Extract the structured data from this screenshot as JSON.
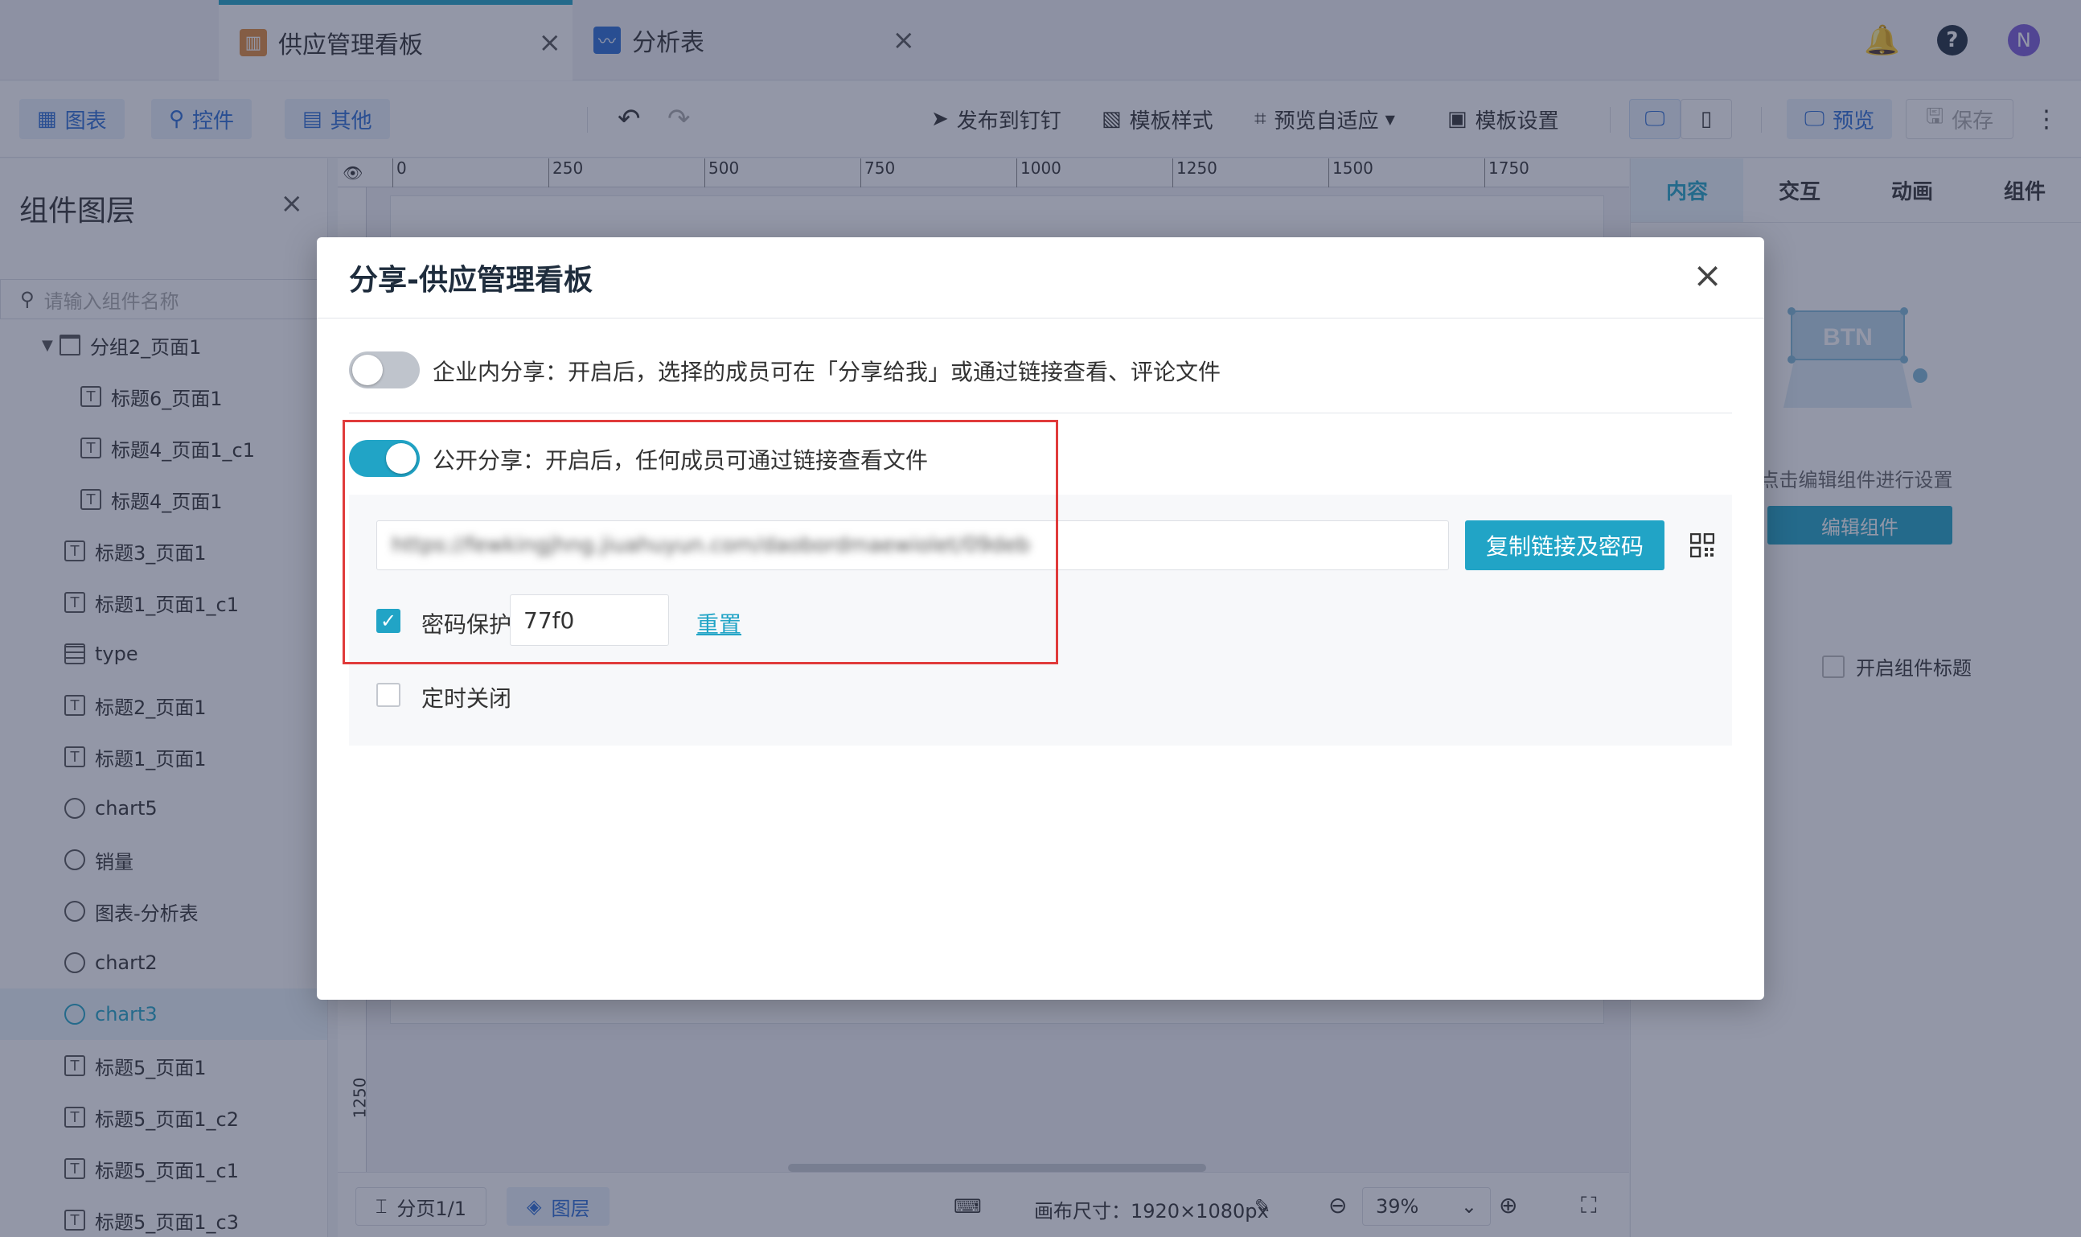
{
  "tabs": [
    {
      "label": "供应管理看板",
      "icon": "dashboard-icon",
      "active": true
    },
    {
      "label": "分析表",
      "icon": "analysis-chart-icon",
      "active": false
    }
  ],
  "user_avatar": "N",
  "toolbar": {
    "left_buttons": [
      {
        "label": "图表",
        "icon": "chart-icon"
      },
      {
        "label": "控件",
        "icon": "widget-icon"
      },
      {
        "label": "其他",
        "icon": "other-icon"
      }
    ],
    "publish": "发布到钉钉",
    "template_style": "模板样式",
    "preview_adapt": "预览自适应",
    "template_settings": "模板设置",
    "preview": "预览",
    "save": "保存"
  },
  "layers_panel": {
    "title": "组件图层",
    "search_placeholder": "请输入组件名称",
    "items": [
      {
        "label": "分组2_页面1",
        "icon": "folder-icon",
        "level": 0,
        "expanded": true
      },
      {
        "label": "标题6_页面1",
        "icon": "text-icon",
        "level": 1
      },
      {
        "label": "标题4_页面1_c1",
        "icon": "text-icon",
        "level": 1
      },
      {
        "label": "标题4_页面1",
        "icon": "text-icon",
        "level": 1
      },
      {
        "label": "标题3_页面1",
        "icon": "text-icon",
        "level": 0
      },
      {
        "label": "标题1_页面1_c1",
        "icon": "text-icon",
        "level": 0
      },
      {
        "label": "type",
        "icon": "table-icon",
        "level": 0
      },
      {
        "label": "标题2_页面1",
        "icon": "text-icon",
        "level": 0
      },
      {
        "label": "标题1_页面1",
        "icon": "text-icon",
        "level": 0
      },
      {
        "label": "chart5",
        "icon": "pie-chart-icon",
        "level": 0
      },
      {
        "label": "销量",
        "icon": "pie-chart-icon",
        "level": 0
      },
      {
        "label": "图表-分析表",
        "icon": "pie-chart-icon",
        "level": 0
      },
      {
        "label": "chart2",
        "icon": "pie-chart-icon",
        "level": 0
      },
      {
        "label": "chart3",
        "icon": "pie-chart-icon",
        "level": 0,
        "selected": true
      },
      {
        "label": "标题5_页面1",
        "icon": "text-icon",
        "level": 0
      },
      {
        "label": "标题5_页面1_c2",
        "icon": "text-icon",
        "level": 0
      },
      {
        "label": "标题5_页面1_c1",
        "icon": "text-icon",
        "level": 0
      },
      {
        "label": "标题5_页面1_c3",
        "icon": "text-icon",
        "level": 0
      }
    ]
  },
  "ruler": {
    "labels": [
      "0",
      "250",
      "500",
      "750",
      "1000",
      "1250",
      "1500",
      "1750"
    ],
    "vertical_label": "1250"
  },
  "bottom": {
    "pages": "分页1/1",
    "layers": "图层",
    "canvas_size": "画布尺寸：1920×1080px",
    "zoom": "39%"
  },
  "right_panel": {
    "tabs": [
      "内容",
      "交互",
      "动画",
      "组件"
    ],
    "active_tab": "内容",
    "illustration_text": "BTN",
    "hint": "点击编辑组件进行设置",
    "edit_button": "编辑组件",
    "enable_title": "开启组件标题"
  },
  "modal": {
    "title": "分享-供应管理看板",
    "internal_share": {
      "enabled": false,
      "text": "企业内分享：开启后，选择的成员可在「分享给我」或通过链接查看、评论文件"
    },
    "public_share": {
      "enabled": true,
      "text": "公开分享：开启后，任何成员可通过链接查看文件"
    },
    "link": "https://fewkingjhng.jiuahuyun.com/daobordmaewiolet/09deb",
    "copy_button": "复制链接及密码",
    "password_protect": {
      "checked": true,
      "label": "密码保护",
      "value": "77f0",
      "reset": "重置"
    },
    "timed_close": {
      "checked": false,
      "label": "定时关闭"
    }
  },
  "colors": {
    "accent": "#21a4c6",
    "highlight": "#e03b3b",
    "overlay": "rgba(40,48,80,0.5)"
  }
}
